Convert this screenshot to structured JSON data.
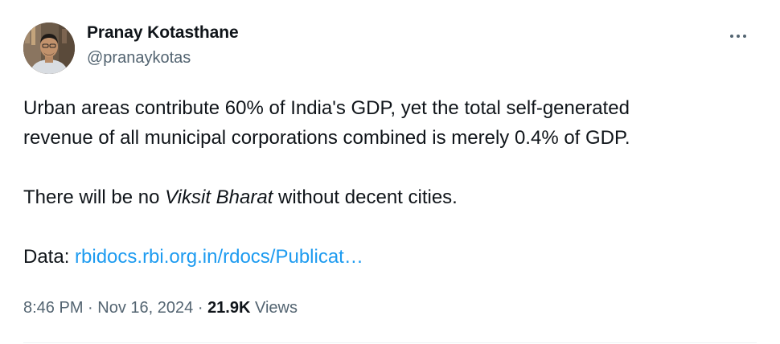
{
  "author": {
    "name": "Pranay Kotasthane",
    "handle": "@pranaykotas"
  },
  "tweet": {
    "line1": "Urban areas contribute 60% of India's GDP, yet the total self-generated",
    "line2": "revenue of all municipal corporations combined is merely 0.4% of GDP.",
    "p2_before": "There will be no ",
    "p2_italic": "Viksit Bharat",
    "p2_after": " without decent cities.",
    "data_label": "Data: ",
    "data_link": "rbidocs.rbi.org.in/rdocs/Publicat…"
  },
  "meta": {
    "time": "8:46 PM",
    "separator": "·",
    "date": "Nov 16, 2024",
    "views_count": "21.9K",
    "views_label": "Views"
  },
  "icons": {
    "more": "more-horizontal-icon",
    "avatar": "profile-photo"
  },
  "colors": {
    "text": "#0f1419",
    "secondary": "#536471",
    "link": "#1d9bf0"
  }
}
